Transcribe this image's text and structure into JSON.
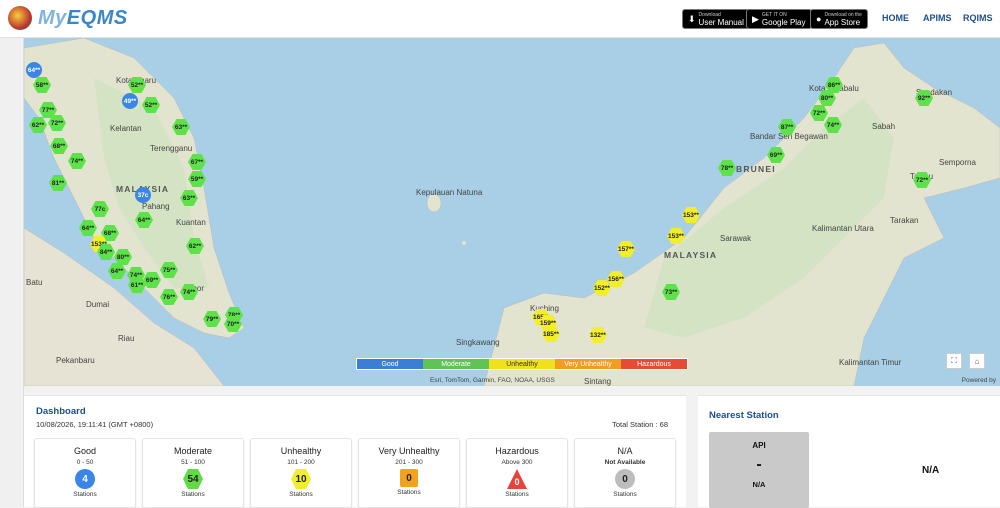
{
  "header": {
    "brand_my": "My",
    "brand_name": "EQMS",
    "store_buttons": [
      {
        "small": "Download",
        "large": "User Manual",
        "icon": "download-icon"
      },
      {
        "small": "GET IT ON",
        "large": "Google Play",
        "icon": "play-icon"
      },
      {
        "small": "Download on the",
        "large": "App Store",
        "icon": "apple-icon"
      }
    ],
    "nav": [
      "HOME",
      "APIMS",
      "RQIMS"
    ]
  },
  "map": {
    "labels": [
      {
        "text": "MALAYSIA",
        "big": true
      },
      {
        "text": "MALAYSIA",
        "big": true
      },
      {
        "text": "BRUNEI",
        "big": true
      },
      {
        "text": "Kota Bharu"
      },
      {
        "text": "Kelantan"
      },
      {
        "text": "Terengganu"
      },
      {
        "text": "Pahang"
      },
      {
        "text": "Kuantan"
      },
      {
        "text": "Johor"
      },
      {
        "text": "Batu"
      },
      {
        "text": "Dumai"
      },
      {
        "text": "Pekanbaru"
      },
      {
        "text": "Riau"
      },
      {
        "text": "Singkawang"
      },
      {
        "text": "Kuching"
      },
      {
        "text": "Sarawak"
      },
      {
        "text": "Sabah"
      },
      {
        "text": "Sandakan"
      },
      {
        "text": "Tawau"
      },
      {
        "text": "Tarakan"
      },
      {
        "text": "Kota Kinabalu"
      },
      {
        "text": "Bandar Seri Begawan"
      },
      {
        "text": "Semporna"
      },
      {
        "text": "Kalimantan Utara"
      },
      {
        "text": "Kalimantan Timur"
      },
      {
        "text": "Sintang"
      },
      {
        "text": "Kepulauan Natuna"
      }
    ],
    "markers": [
      {
        "v": "64**",
        "c": "b"
      },
      {
        "v": "58**",
        "c": "g"
      },
      {
        "v": "52**",
        "c": "g"
      },
      {
        "v": "49**",
        "c": "b"
      },
      {
        "v": "52**",
        "c": "g"
      },
      {
        "v": "77**",
        "c": "g"
      },
      {
        "v": "62**",
        "c": "g"
      },
      {
        "v": "72**",
        "c": "g"
      },
      {
        "v": "63**",
        "c": "g"
      },
      {
        "v": "68**",
        "c": "g"
      },
      {
        "v": "74**",
        "c": "g"
      },
      {
        "v": "81**",
        "c": "g"
      },
      {
        "v": "67**",
        "c": "g"
      },
      {
        "v": "59**",
        "c": "g"
      },
      {
        "v": "37c",
        "c": "b"
      },
      {
        "v": "63**",
        "c": "g"
      },
      {
        "v": "64**",
        "c": "g"
      },
      {
        "v": "77c",
        "c": "g"
      },
      {
        "v": "64**",
        "c": "g"
      },
      {
        "v": "68**",
        "c": "g"
      },
      {
        "v": "153**",
        "c": "y"
      },
      {
        "v": "84**",
        "c": "g"
      },
      {
        "v": "80**",
        "c": "g"
      },
      {
        "v": "62**",
        "c": "g"
      },
      {
        "v": "75**",
        "c": "g"
      },
      {
        "v": "64**",
        "c": "g"
      },
      {
        "v": "74**",
        "c": "g"
      },
      {
        "v": "61**",
        "c": "g"
      },
      {
        "v": "69**",
        "c": "g"
      },
      {
        "v": "74**",
        "c": "g"
      },
      {
        "v": "76**",
        "c": "g"
      },
      {
        "v": "79**",
        "c": "g"
      },
      {
        "v": "78**",
        "c": "g"
      },
      {
        "v": "70**",
        "c": "g"
      },
      {
        "v": "86**",
        "c": "g"
      },
      {
        "v": "80**",
        "c": "g"
      },
      {
        "v": "72**",
        "c": "g"
      },
      {
        "v": "74**",
        "c": "g"
      },
      {
        "v": "87**",
        "c": "g"
      },
      {
        "v": "69**",
        "c": "g"
      },
      {
        "v": "78**",
        "c": "g"
      },
      {
        "v": "92**",
        "c": "g"
      },
      {
        "v": "72**",
        "c": "g"
      },
      {
        "v": "153**",
        "c": "y"
      },
      {
        "v": "153**",
        "c": "y"
      },
      {
        "v": "157**",
        "c": "y"
      },
      {
        "v": "156**",
        "c": "y"
      },
      {
        "v": "152**",
        "c": "y"
      },
      {
        "v": "73**",
        "c": "g"
      },
      {
        "v": "165**",
        "c": "y"
      },
      {
        "v": "159**",
        "c": "y"
      },
      {
        "v": "185**",
        "c": "y"
      },
      {
        "v": "132**",
        "c": "y"
      }
    ],
    "legend": [
      {
        "label": "Good",
        "color": "#3a7fd5"
      },
      {
        "label": "Moderate",
        "color": "#5fc455"
      },
      {
        "label": "Unhealthy",
        "color": "#f0e11c"
      },
      {
        "label": "Very Unhealthy",
        "color": "#f29c21"
      },
      {
        "label": "Hazardous",
        "color": "#e84b35"
      }
    ],
    "attribution": "Esri, TomTom, Garmin, FAO, NOAA, USGS",
    "powered": "Powered by"
  },
  "dashboard": {
    "title": "Dashboard",
    "datetime": "10/08/2026, 19:11:41 (GMT +0800)",
    "total": "Total Station : 68",
    "cards": [
      {
        "name": "Good",
        "range": "0 - 50",
        "count": "4",
        "unit": "Stations",
        "color": "#3a86e6",
        "shape": "circle",
        "text_color": "#fff",
        "bold_range": false
      },
      {
        "name": "Moderate",
        "range": "51 - 100",
        "count": "54",
        "unit": "Stations",
        "color": "#5fdc45",
        "shape": "hexagon",
        "text_color": "#222",
        "bold_range": false
      },
      {
        "name": "Unhealthy",
        "range": "101 - 200",
        "count": "10",
        "unit": "Stations",
        "color": "#f2ee2a",
        "shape": "hexagon",
        "text_color": "#222",
        "bold_range": false
      },
      {
        "name": "Very Unhealthy",
        "range": "201 - 300",
        "count": "0",
        "unit": "Stations",
        "color": "#f3a21a",
        "shape": "square",
        "text_color": "#222",
        "bold_range": false
      },
      {
        "name": "Hazardous",
        "range": "Above 300",
        "count": "0",
        "unit": "Stations",
        "color": "#e8433a",
        "shape": "triangle",
        "text_color": "#fff",
        "bold_range": false
      },
      {
        "name": "N/A",
        "range": "Not Available",
        "count": "0",
        "unit": "Stations",
        "color": "#bdbdbd",
        "shape": "circle",
        "text_color": "#222",
        "bold_range": true
      }
    ]
  },
  "nearest": {
    "title": "Nearest Station",
    "api_label": "API",
    "api_value": "-",
    "api_status": "N/A",
    "station_name": "N/A"
  }
}
